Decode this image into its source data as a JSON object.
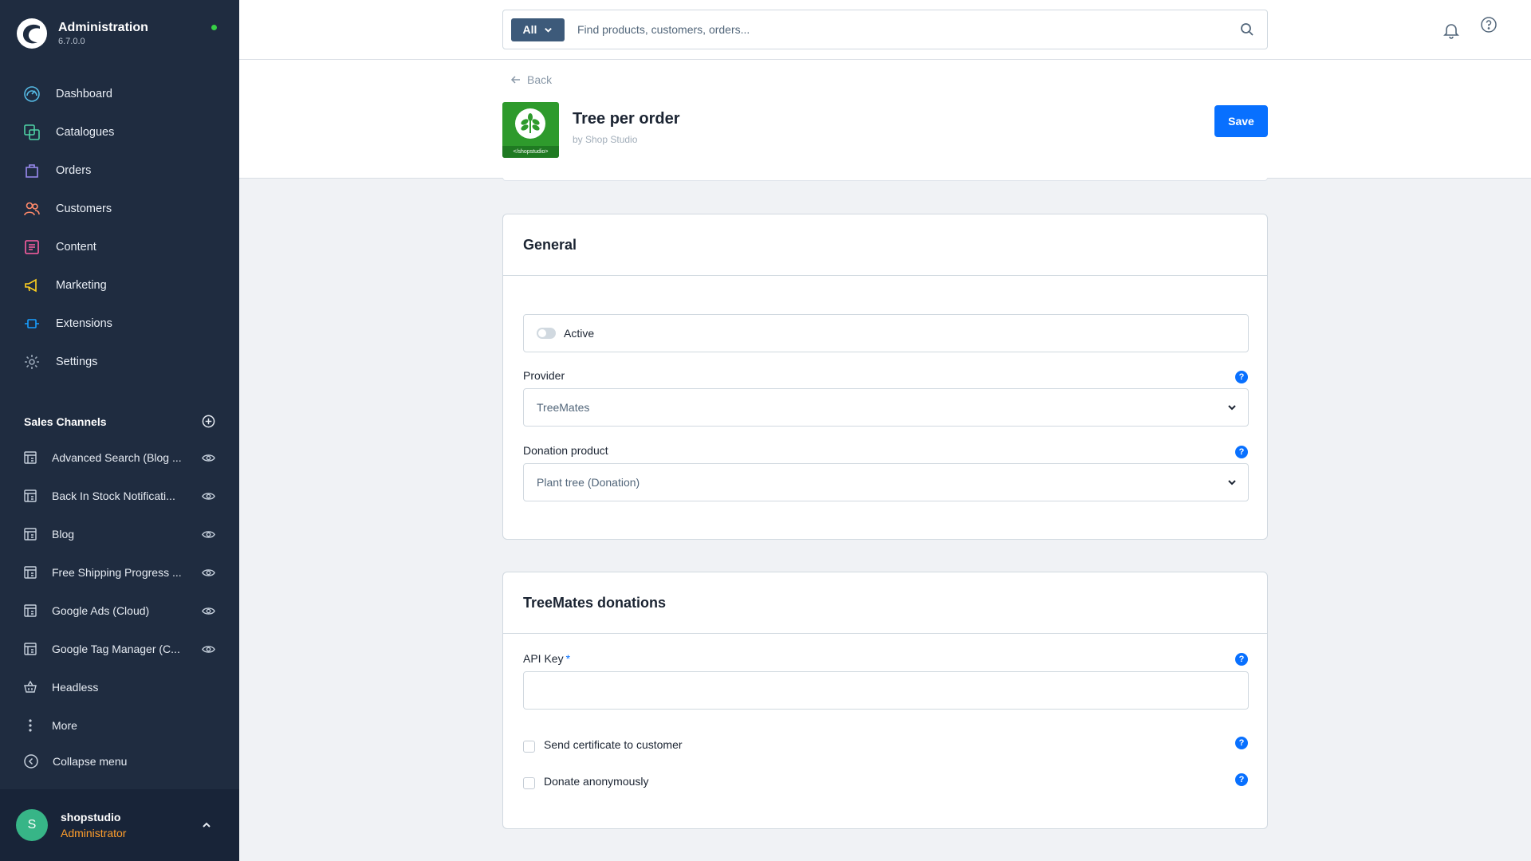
{
  "app": {
    "title": "Administration",
    "version": "6.7.0.0"
  },
  "nav": [
    {
      "label": "Dashboard",
      "icon": "dashboard-icon"
    },
    {
      "label": "Catalogues",
      "icon": "catalogue-icon"
    },
    {
      "label": "Orders",
      "icon": "orders-icon"
    },
    {
      "label": "Customers",
      "icon": "customers-icon"
    },
    {
      "label": "Content",
      "icon": "content-icon"
    },
    {
      "label": "Marketing",
      "icon": "marketing-icon"
    },
    {
      "label": "Extensions",
      "icon": "extensions-icon"
    },
    {
      "label": "Settings",
      "icon": "settings-icon"
    }
  ],
  "sales_channels": {
    "title": "Sales Channels",
    "items": [
      {
        "label": "Advanced Search (Blog ..."
      },
      {
        "label": "Back In Stock Notificati..."
      },
      {
        "label": "Blog"
      },
      {
        "label": "Free Shipping Progress ..."
      },
      {
        "label": "Google Ads (Cloud)"
      },
      {
        "label": "Google Tag Manager (C..."
      },
      {
        "label": "Headless"
      },
      {
        "label": "More"
      }
    ],
    "collapse_label": "Collapse menu"
  },
  "user": {
    "initial": "S",
    "name": "shopstudio",
    "role": "Administrator"
  },
  "search": {
    "type": "All",
    "placeholder": "Find products, customers, orders..."
  },
  "header": {
    "back": "Back",
    "title": "Tree per order",
    "author": "by Shop Studio",
    "logo_tag": "</shopstudio>",
    "save": "Save"
  },
  "general": {
    "title": "General",
    "active_label": "Active",
    "provider_label": "Provider",
    "provider_value": "TreeMates",
    "donation_label": "Donation product",
    "donation_value": "Plant tree (Donation)"
  },
  "treemates": {
    "title": "TreeMates donations",
    "api_label": "API Key",
    "api_required": "*",
    "api_value": "",
    "certificate_label": "Send certificate to customer",
    "anonymous_label": "Donate anonymously"
  },
  "colors": {
    "sidebar": "#1f2c40",
    "accent": "#0870ff",
    "status": "#37d046",
    "role": "#ff9e2c"
  }
}
